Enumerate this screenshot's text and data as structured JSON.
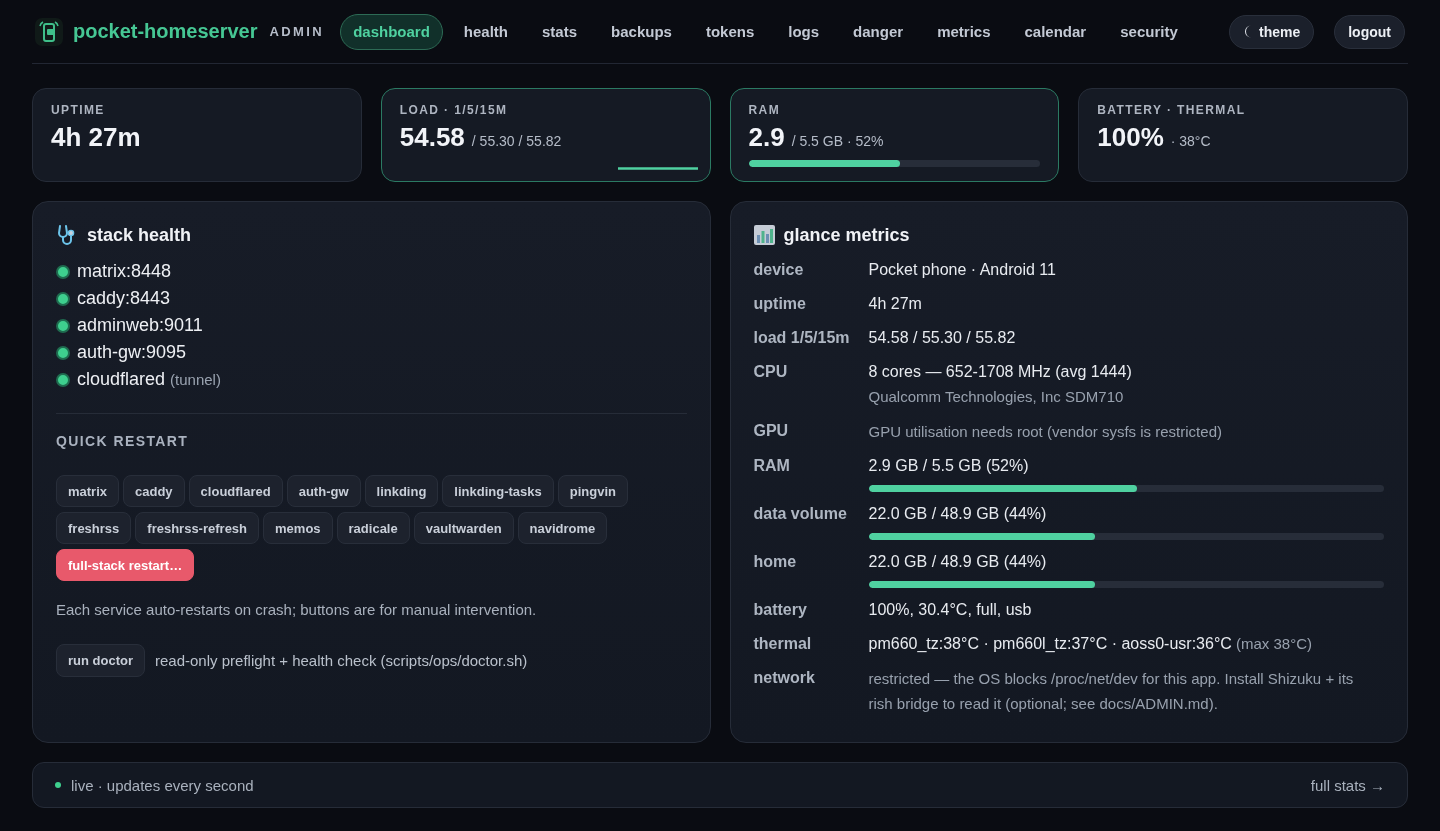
{
  "header": {
    "brand": "pocket-homeserver",
    "role": "ADMIN",
    "tabs": [
      {
        "label": "dashboard",
        "selected": true
      },
      {
        "label": "health",
        "selected": false
      },
      {
        "label": "stats",
        "selected": false
      },
      {
        "label": "backups",
        "selected": false
      },
      {
        "label": "tokens",
        "selected": false
      },
      {
        "label": "logs",
        "selected": false
      },
      {
        "label": "danger",
        "selected": false
      },
      {
        "label": "metrics",
        "selected": false
      },
      {
        "label": "calendar",
        "selected": false
      },
      {
        "label": "security",
        "selected": false
      }
    ],
    "actions": [
      {
        "label": "theme",
        "kind": "theme"
      },
      {
        "label": "logout",
        "kind": "plain"
      }
    ]
  },
  "stats": [
    {
      "label": "UPTIME",
      "value": "4h 27m",
      "kind": "plain",
      "highlighted": false
    },
    {
      "label": "LOAD · 1/5/15M",
      "value": "54.58",
      "detail": "/ 55.30 / 55.82",
      "kind": "sparkline",
      "highlighted": true
    },
    {
      "label": "RAM",
      "value": "2.9",
      "detail": "/ 5.5 GB · 52%",
      "kind": "bar",
      "level": 0.52,
      "highlighted": true
    },
    {
      "label": "BATTERY · THERMAL",
      "value": "100%",
      "detail": "· 38°C",
      "kind": "plain",
      "highlighted": false
    }
  ],
  "stack_health": {
    "title": "stack health",
    "services": [
      {
        "name": "matrix:8448",
        "healthy": true
      },
      {
        "name": "caddy:8443",
        "healthy": true
      },
      {
        "name": "adminweb:9011",
        "healthy": true
      },
      {
        "name": "auth-gw:9095",
        "healthy": true
      },
      {
        "name": "cloudflared",
        "note": "(tunnel)",
        "healthy": true
      }
    ],
    "quick_restart": {
      "title": "QUICK RESTART",
      "buttons": [
        {
          "label": "matrix",
          "kind": "service"
        },
        {
          "label": "caddy",
          "kind": "service"
        },
        {
          "label": "cloudflared",
          "kind": "service"
        },
        {
          "label": "auth-gw",
          "kind": "service"
        },
        {
          "label": "linkding",
          "kind": "service"
        },
        {
          "label": "linkding-tasks",
          "kind": "service"
        },
        {
          "label": "pingvin",
          "kind": "service"
        },
        {
          "label": "freshrss",
          "kind": "service"
        },
        {
          "label": "freshrss-refresh",
          "kind": "service"
        },
        {
          "label": "memos",
          "kind": "service"
        },
        {
          "label": "radicale",
          "kind": "service"
        },
        {
          "label": "vaultwarden",
          "kind": "service"
        },
        {
          "label": "navidrome",
          "kind": "service"
        },
        {
          "label": "full-stack restart…",
          "kind": "danger"
        }
      ]
    },
    "note": "Each service auto-restarts on crash; buttons are for manual intervention.",
    "doctor": {
      "button": "run doctor",
      "description": "read-only preflight + health check (scripts/ops/doctor.sh)"
    }
  },
  "glance_metrics": {
    "title": "glance metrics",
    "rows": [
      {
        "label": "device",
        "kind": "text",
        "muted": false,
        "value": "Pocket phone · Android 11"
      },
      {
        "label": "uptime",
        "kind": "text",
        "muted": false,
        "value": "4h 27m"
      },
      {
        "label": "load 1/5/15m",
        "kind": "text",
        "muted": false,
        "value": "54.58 / 55.30 / 55.82"
      },
      {
        "label": "CPU",
        "kind": "text",
        "muted": false,
        "value": "8 cores — 652-1708 MHz (avg 1444)",
        "sub": "Qualcomm Technologies, Inc SDM710"
      },
      {
        "label": "GPU",
        "kind": "text",
        "muted": true,
        "value": "GPU utilisation needs root (vendor sysfs is restricted)"
      },
      {
        "label": "RAM",
        "kind": "bar",
        "muted": false,
        "value": "2.9 GB / 5.5 GB (52%)",
        "level": 0.52
      },
      {
        "label": "data volume",
        "kind": "bar",
        "muted": false,
        "value": "22.0 GB / 48.9 GB (44%)",
        "level": 0.44
      },
      {
        "label": "home",
        "kind": "bar",
        "muted": false,
        "value": "22.0 GB / 48.9 GB (44%)",
        "level": 0.44
      },
      {
        "label": "battery",
        "kind": "text",
        "muted": false,
        "value": "100%, 30.4°C, full, usb"
      },
      {
        "label": "thermal",
        "kind": "text",
        "muted": false,
        "value": "pm660_tz:38°C · pm660l_tz:37°C · aoss0-usr:36°C",
        "note": "(max 38°C)"
      },
      {
        "label": "network",
        "kind": "text",
        "muted": true,
        "value": "restricted — the OS blocks /proc/net/dev for this app. Install Shizuku + its rish bridge to read it (optional; see docs/ADMIN.md)."
      }
    ]
  },
  "status_bar": {
    "live": true,
    "text": "live · updates every second",
    "link": "full stats →"
  }
}
